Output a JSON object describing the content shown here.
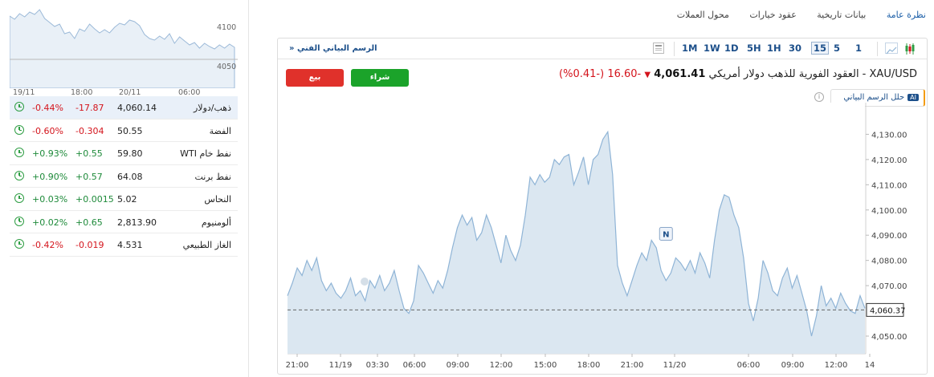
{
  "mini_chart": {
    "y_labels": [
      "4100",
      "4050"
    ],
    "x_labels": [
      "19/11",
      "18:00",
      "20/11",
      "06:00"
    ]
  },
  "table": [
    {
      "name": "ذهب/دولار",
      "last": "4,060.14",
      "chg": "-17.87",
      "pct": "-0.44%",
      "dir": "neg",
      "active": true
    },
    {
      "name": "الفضة",
      "last": "50.55",
      "chg": "-0.304",
      "pct": "-0.60%",
      "dir": "neg"
    },
    {
      "name": "نفط خام WTI",
      "last": "59.80",
      "chg": "+0.55",
      "pct": "+0.93%",
      "dir": "pos"
    },
    {
      "name": "نفط برنت",
      "last": "64.08",
      "chg": "+0.57",
      "pct": "+0.90%",
      "dir": "pos"
    },
    {
      "name": "النحاس",
      "last": "5.02",
      "chg": "+0.0015",
      "pct": "+0.03%",
      "dir": "pos"
    },
    {
      "name": "ألومنيوم",
      "last": "2,813.90",
      "chg": "+0.65",
      "pct": "+0.02%",
      "dir": "pos"
    },
    {
      "name": "الغاز الطبيعي",
      "last": "4.531",
      "chg": "-0.019",
      "pct": "-0.42%",
      "dir": "neg"
    }
  ],
  "nav": {
    "overview": "نظرة عامة",
    "historical": "بيانات تاريخية",
    "options": "عقود خيارات",
    "converter": "محول العملات"
  },
  "toolbar": {
    "technical": "الرسم البياني الفني «",
    "timeframes": [
      "1",
      "5",
      "15",
      "30",
      "1H",
      "5H",
      "1D",
      "1W",
      "1M"
    ],
    "selected": "15"
  },
  "actions": {
    "sell": "بيع",
    "buy": "شراء",
    "analyze": "حلل الرسم البياني",
    "ai": "AI"
  },
  "quote": {
    "name": "XAU/USD - العقود الفورية للذهب دولار أمريكي",
    "price": "4,061.41",
    "change": "-16.60",
    "pct": "(-0.41%)"
  },
  "chart_data": {
    "type": "area",
    "x_tick_labels": [
      "21:00",
      "11/19",
      "03:30",
      "06:00",
      "09:00",
      "12:00",
      "15:00",
      "18:00",
      "21:00",
      "11/20",
      "06:00",
      "09:00",
      "12:00",
      "14"
    ],
    "y_tick_labels": [
      "4,130.00",
      "4,120.00",
      "4,110.00",
      "4,100.00",
      "4,090.00",
      "4,080.00",
      "4,070.00",
      "4,060.37",
      "4,050.00"
    ],
    "ylim": [
      4043,
      4133
    ],
    "current_price": 4060.37,
    "current_label": "4,060.37",
    "marker": "N",
    "values": [
      4066,
      4071,
      4077,
      4074,
      4080,
      4076,
      4081,
      4072,
      4068,
      4071,
      4067,
      4065,
      4068,
      4073,
      4066,
      4068,
      4064,
      4072,
      4069,
      4074,
      4068,
      4071,
      4076,
      4068,
      4061,
      4059,
      4064,
      4078,
      4075,
      4071,
      4067,
      4072,
      4069,
      4076,
      4085,
      4093,
      4098,
      4094,
      4097,
      4088,
      4091,
      4098,
      4093,
      4086,
      4079,
      4090,
      4084,
      4080,
      4086,
      4098,
      4113,
      4110,
      4114,
      4111,
      4113,
      4120,
      4118,
      4121,
      4122,
      4110,
      4115,
      4121,
      4110,
      4120,
      4122,
      4128,
      4131,
      4114,
      4078,
      4071,
      4066,
      4072,
      4078,
      4083,
      4080,
      4088,
      4085,
      4076,
      4072,
      4075,
      4081,
      4079,
      4076,
      4080,
      4075,
      4083,
      4079,
      4073,
      4088,
      4100,
      4106,
      4105,
      4098,
      4093,
      4081,
      4063,
      4056,
      4065,
      4080,
      4075,
      4068,
      4066,
      4073,
      4077,
      4069,
      4074,
      4067,
      4060,
      4050,
      4058,
      4070,
      4062,
      4065,
      4061,
      4067,
      4063,
      4060,
      4059,
      4066,
      4061
    ]
  },
  "colors": {
    "area_fill": "#dbe7f1",
    "area_line": "#8fb4d6",
    "negative": "#d4141c",
    "positive": "#1e8a3a",
    "accent": "#1c4f8a"
  }
}
